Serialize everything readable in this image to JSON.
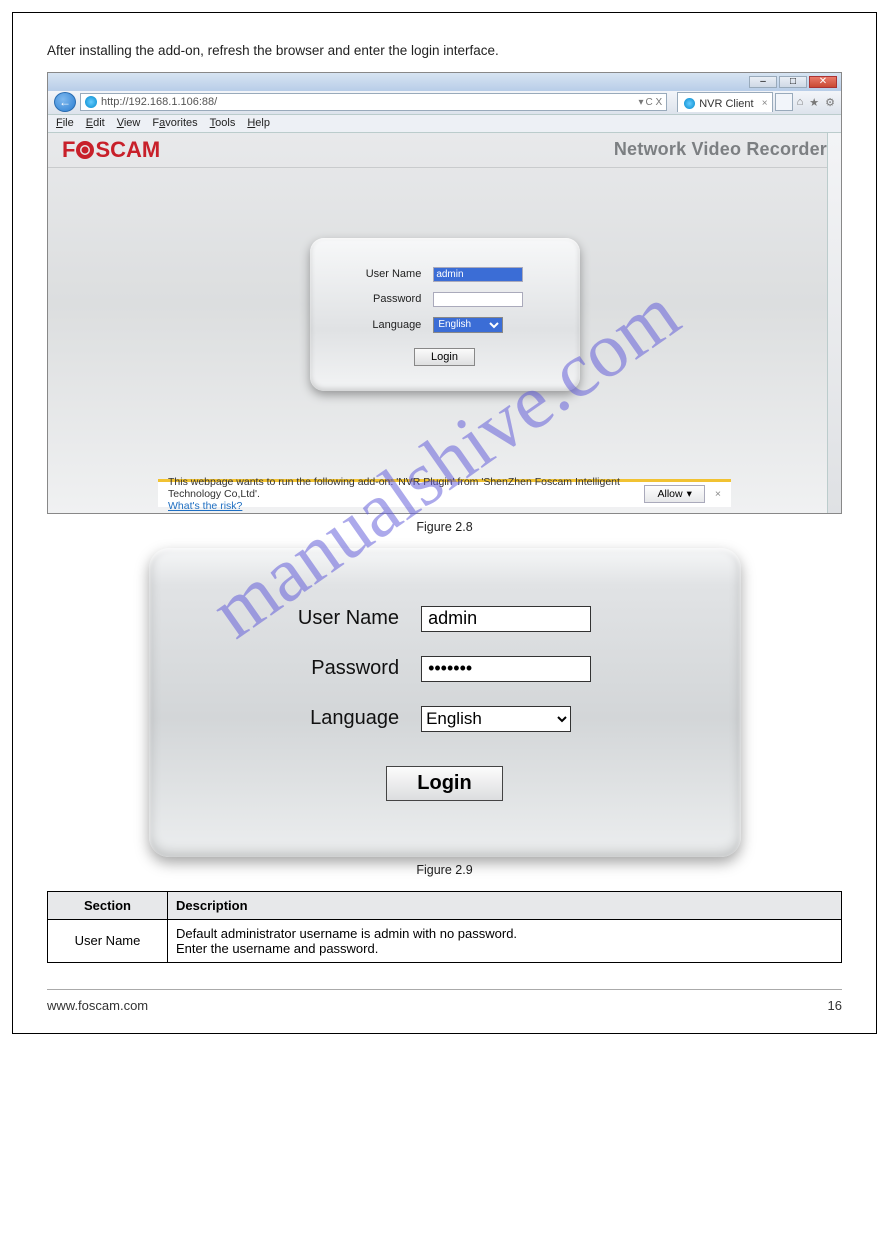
{
  "intro": "After installing the add-on, refresh the browser and enter the login interface.",
  "watermark": "manualshive.com",
  "browser": {
    "url": "http://192.168.1.106:88/",
    "refresh_hint": "C X",
    "tab_title": "NVR Client",
    "menu": [
      "File",
      "Edit",
      "View",
      "Favorites",
      "Tools",
      "Help"
    ],
    "window_buttons": [
      "–",
      "□",
      "✕"
    ]
  },
  "brand": {
    "logo_rest": "SCAM",
    "title": "Network Video Recorder"
  },
  "login_small": {
    "username_label": "User Name",
    "username_value": "admin",
    "password_label": "Password",
    "password_value": "",
    "language_label": "Language",
    "language_value": "English",
    "button": "Login"
  },
  "addon_bar": {
    "message": "This webpage wants to run the following add-on: 'NVR Plugin' from 'ShenZhen Foscam Intelligent Technology Co,Ltd'.",
    "risk_link": "What's the risk?",
    "allow": "Allow",
    "close": "×"
  },
  "figure28": "Figure 2.8",
  "login_big": {
    "username_label": "User Name",
    "username_value": "admin",
    "password_label": "Password",
    "password_value": "•••••••",
    "language_label": "Language",
    "language_value": "English",
    "button": "Login"
  },
  "figure29": "Figure 2.9",
  "table": {
    "h1": "Section",
    "h2": "Description",
    "row1_c1": "User Name",
    "row1_c2": "Default administrator username is admin with no password.\nEnter the username and password."
  },
  "footer": {
    "url": "www.foscam.com",
    "page": "16"
  }
}
